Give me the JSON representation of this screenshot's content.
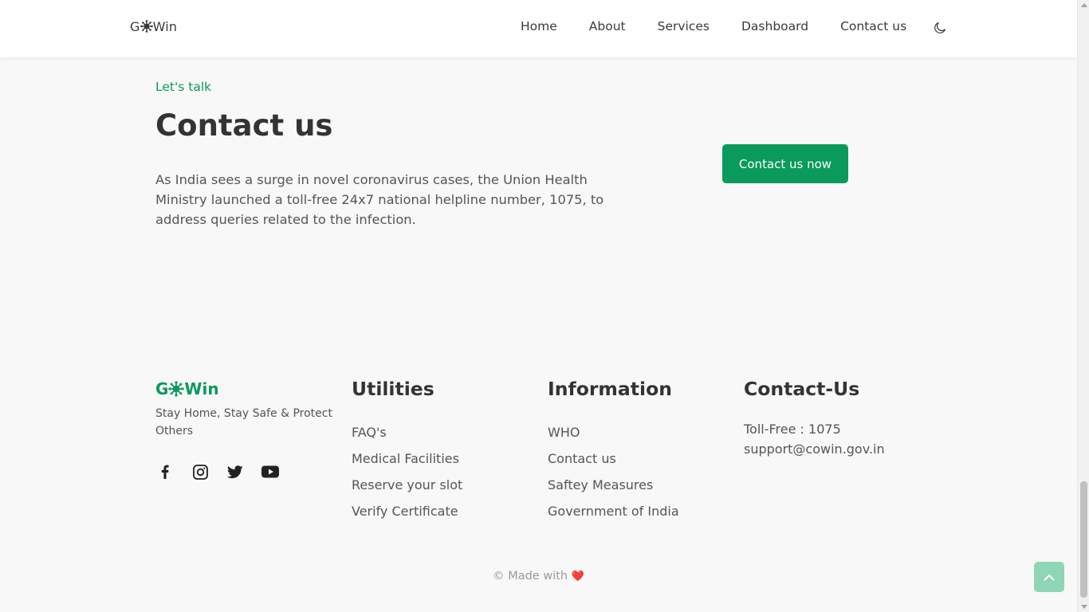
{
  "colors": {
    "accent": "#0a9a5c",
    "accent_light": "#8ed6b4",
    "heart": "#e0243a"
  },
  "header": {
    "brand_prefix": "G",
    "brand_suffix": "Win",
    "nav": [
      "Home",
      "About",
      "Services",
      "Dashboard",
      "Contact us"
    ],
    "theme_icon": "moon-icon"
  },
  "contact": {
    "eyebrow": "Let's talk",
    "title": "Contact us",
    "description": "As India sees a surge in novel coronavirus cases, the Union Health Ministry launched a toll-free 24x7 national helpline number, 1075, to address queries related to the infection.",
    "cta_label": "Contact us now"
  },
  "footer": {
    "brand_prefix": "G",
    "brand_suffix": "Win",
    "tagline": "Stay Home, Stay Safe & Protect Others",
    "social_icons": [
      "facebook-icon",
      "instagram-icon",
      "twitter-icon",
      "youtube-icon"
    ],
    "utilities": {
      "heading": "Utilities",
      "links": [
        "FAQ's",
        "Medical Facilities",
        "Reserve your slot",
        "Verify Certificate"
      ]
    },
    "information": {
      "heading": "Information",
      "links": [
        "WHO",
        "Contact us",
        "Saftey Measures",
        "Government of India"
      ]
    },
    "contact_us": {
      "heading": "Contact-Us",
      "phone": "Toll-Free : 1075",
      "email": "support@cowin.gov.in"
    },
    "made_with": "© Made with",
    "heart": "❤️"
  }
}
